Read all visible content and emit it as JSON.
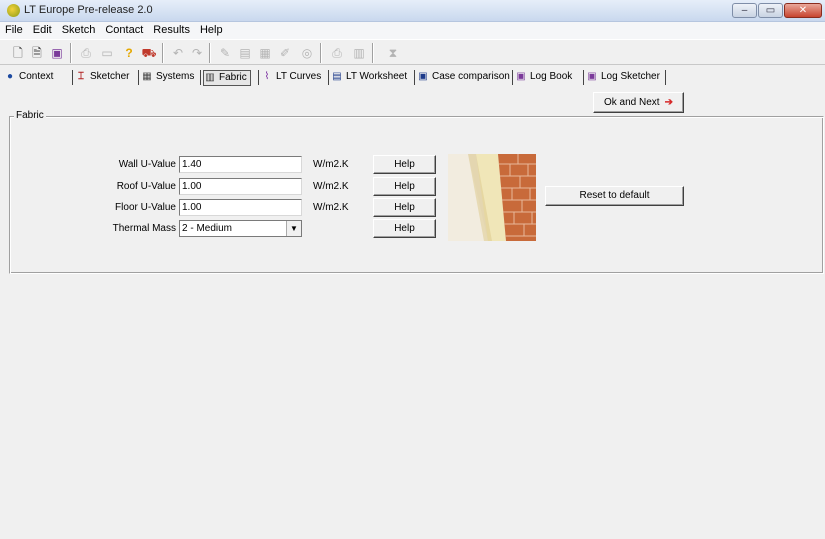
{
  "window": {
    "title": "LT Europe Pre-release 2.0",
    "controls": [
      "–",
      "▭",
      "✕"
    ]
  },
  "menu": [
    "File",
    "Edit",
    "Sketch",
    "Contact",
    "Results",
    "Help"
  ],
  "toolbar": {
    "icons": [
      "new-icon",
      "open-icon",
      "save-icon",
      "print-icon",
      "preview-icon",
      "help-icon",
      "car-icon",
      "undo-icon",
      "redo-icon",
      "tool1-icon",
      "tool2-icon",
      "tool3-icon",
      "tool4-icon",
      "tool5-icon",
      "tool6-icon",
      "tool7-icon",
      "hourglass-icon"
    ]
  },
  "tabs": [
    {
      "label": "Context",
      "icon": "globe-icon",
      "active": false
    },
    {
      "label": "Sketcher",
      "icon": "sketcher-icon",
      "active": false
    },
    {
      "label": "Systems",
      "icon": "systems-icon",
      "active": false
    },
    {
      "label": "Fabric",
      "icon": "fabric-icon",
      "active": true
    },
    {
      "label": "LT Curves",
      "icon": "curves-icon",
      "active": false
    },
    {
      "label": "LT Worksheet",
      "icon": "worksheet-icon",
      "active": false
    },
    {
      "label": "Case comparison",
      "icon": "comparison-icon",
      "active": false
    },
    {
      "label": "Log Book",
      "icon": "logbook-icon",
      "active": false
    },
    {
      "label": "Log Sketcher",
      "icon": "logsketcher-icon",
      "active": false
    }
  ],
  "ok_next": "Ok and Next",
  "fabric": {
    "group_label": "Fabric",
    "wall_label": "Wall U-Value",
    "wall_value": "1.40",
    "roof_label": "Roof U-Value",
    "roof_value": "1.00",
    "floor_label": "Floor U-Value",
    "floor_value": "1.00",
    "unit": "W/m2.K",
    "thermal_label": "Thermal Mass",
    "thermal_value": "2 - Medium",
    "help": "Help",
    "reset": "Reset to default"
  }
}
